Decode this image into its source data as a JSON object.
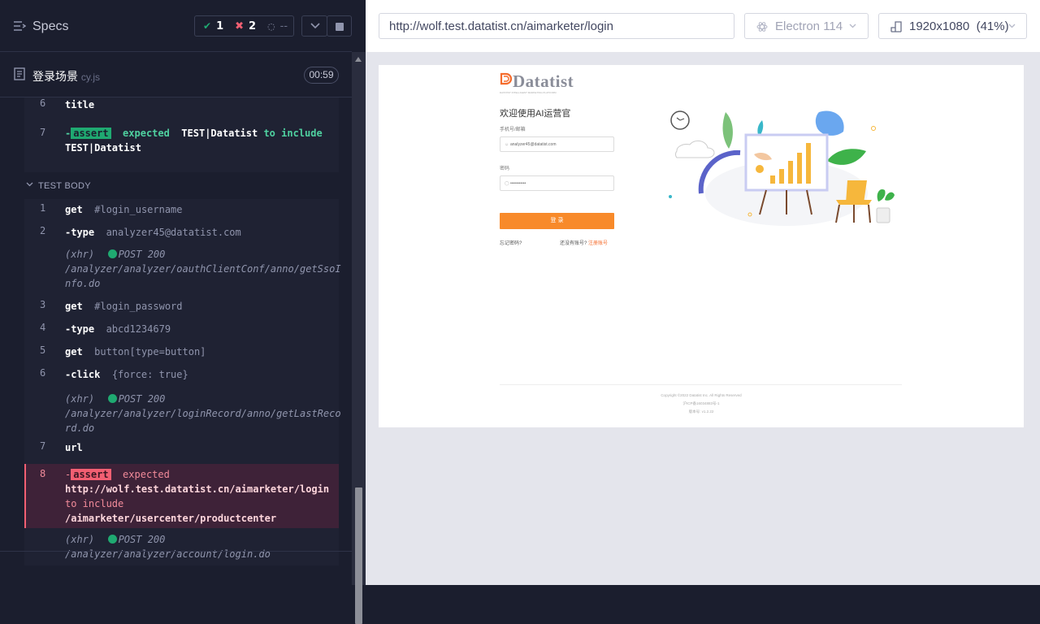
{
  "header": {
    "specs_label": "Specs",
    "passed": "1",
    "failed": "2",
    "pending": "--"
  },
  "spec": {
    "name": "登录场景",
    "ext": "cy.js",
    "duration": "00:59"
  },
  "before_rows": [
    {
      "num": "6",
      "cmd": "title"
    },
    {
      "num": "7",
      "badge": "assert",
      "text_a": "expected",
      "val_a": "TEST|Datatist",
      "text_b": "to include",
      "val_b": "TEST|Datatist"
    }
  ],
  "section_title": "TEST BODY",
  "rows": [
    {
      "num": "1",
      "cmd": "get",
      "arg": "#login_username"
    },
    {
      "num": "2",
      "cmd": "-type",
      "arg": "analyzer45@datatist.com"
    },
    {
      "xhr": "(xhr)",
      "method": "POST 200",
      "path": "/analyzer/analyzer/oauthClientConf/anno/getSsoI",
      "path2": "nfo.do"
    },
    {
      "num": "3",
      "cmd": "get",
      "arg": "#login_password"
    },
    {
      "num": "4",
      "cmd": "-type",
      "arg": "abcd1234679"
    },
    {
      "num": "5",
      "cmd": "get",
      "arg": "button[type=button]"
    },
    {
      "num": "6",
      "cmd": "-click",
      "arg": "{force: true}"
    },
    {
      "xhr": "(xhr)",
      "method": "POST 200",
      "path": "/analyzer/analyzer/loginRecord/anno/getLastReco",
      "path2": "rd.do"
    },
    {
      "num": "7",
      "cmd": "url"
    }
  ],
  "fail_row": {
    "num": "8",
    "badge": "assert",
    "text_a": "expected",
    "val_a": "http://wolf.test.datatist.cn/aimarketer/login",
    "text_b": "to include",
    "val_b": "/aimarketer/usercenter/productcenter"
  },
  "last_xhr": {
    "xhr": "(xhr)",
    "method": "POST 200",
    "path": "/analyzer/analyzer/account/login.do"
  },
  "browser_bar": {
    "url": "http://wolf.test.datatist.cn/aimarketer/login",
    "browser": "Electron 114",
    "viewport": "1920x1080",
    "scale": "(41%)"
  },
  "app": {
    "logo": "Datatist",
    "logo_sub": "DATATIST INTELLIGENT MARKETING PLATFORM",
    "welcome": "欢迎使用AI运营官",
    "phone_label": "手机号/邮箱",
    "phone_value": "analyzer45@datatist.com",
    "pwd_label": "密码",
    "pwd_value": "•••••••••••",
    "login_btn": "登 录",
    "forgot": "忘记密码?",
    "no_account": "还没有账号?",
    "register": "注册账号",
    "footer1": "Copyright ©2022 Datatist Inc. All Rights Reserved",
    "footer2": "沪ICP备16034883号-1",
    "footer3": "版本号: v1.2.22"
  },
  "colors": {
    "pass": "#1fa971",
    "fail": "#f25f72",
    "accent": "#f88a2a"
  }
}
